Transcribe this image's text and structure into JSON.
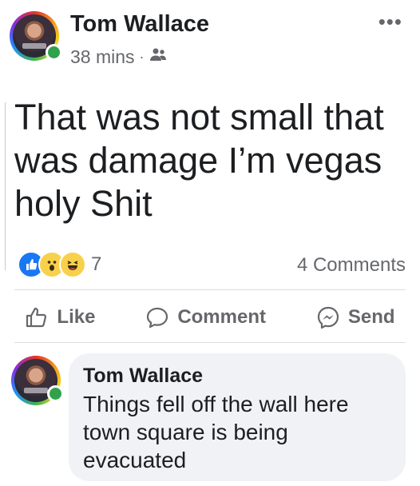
{
  "post": {
    "author": "Tom Wallace",
    "time": "38 mins",
    "separator": "·",
    "privacy_icon": "friends-icon",
    "more_icon": "•••",
    "text": "That was not small that was damage I’m vegas holy Shit"
  },
  "stats": {
    "reaction_icons": [
      "like-icon",
      "wow-icon",
      "haha-icon"
    ],
    "reaction_count": "7",
    "comments_count": "4 Comments"
  },
  "actions": {
    "like": "Like",
    "comment": "Comment",
    "send": "Send"
  },
  "comment": {
    "author": "Tom Wallace",
    "text": "Things fell off the wall here town square is being evacuated"
  },
  "colors": {
    "online": "#31a24c",
    "like_blue": "#1877f2",
    "bubble_bg": "#f0f2f5",
    "secondary_text": "#65676b"
  }
}
